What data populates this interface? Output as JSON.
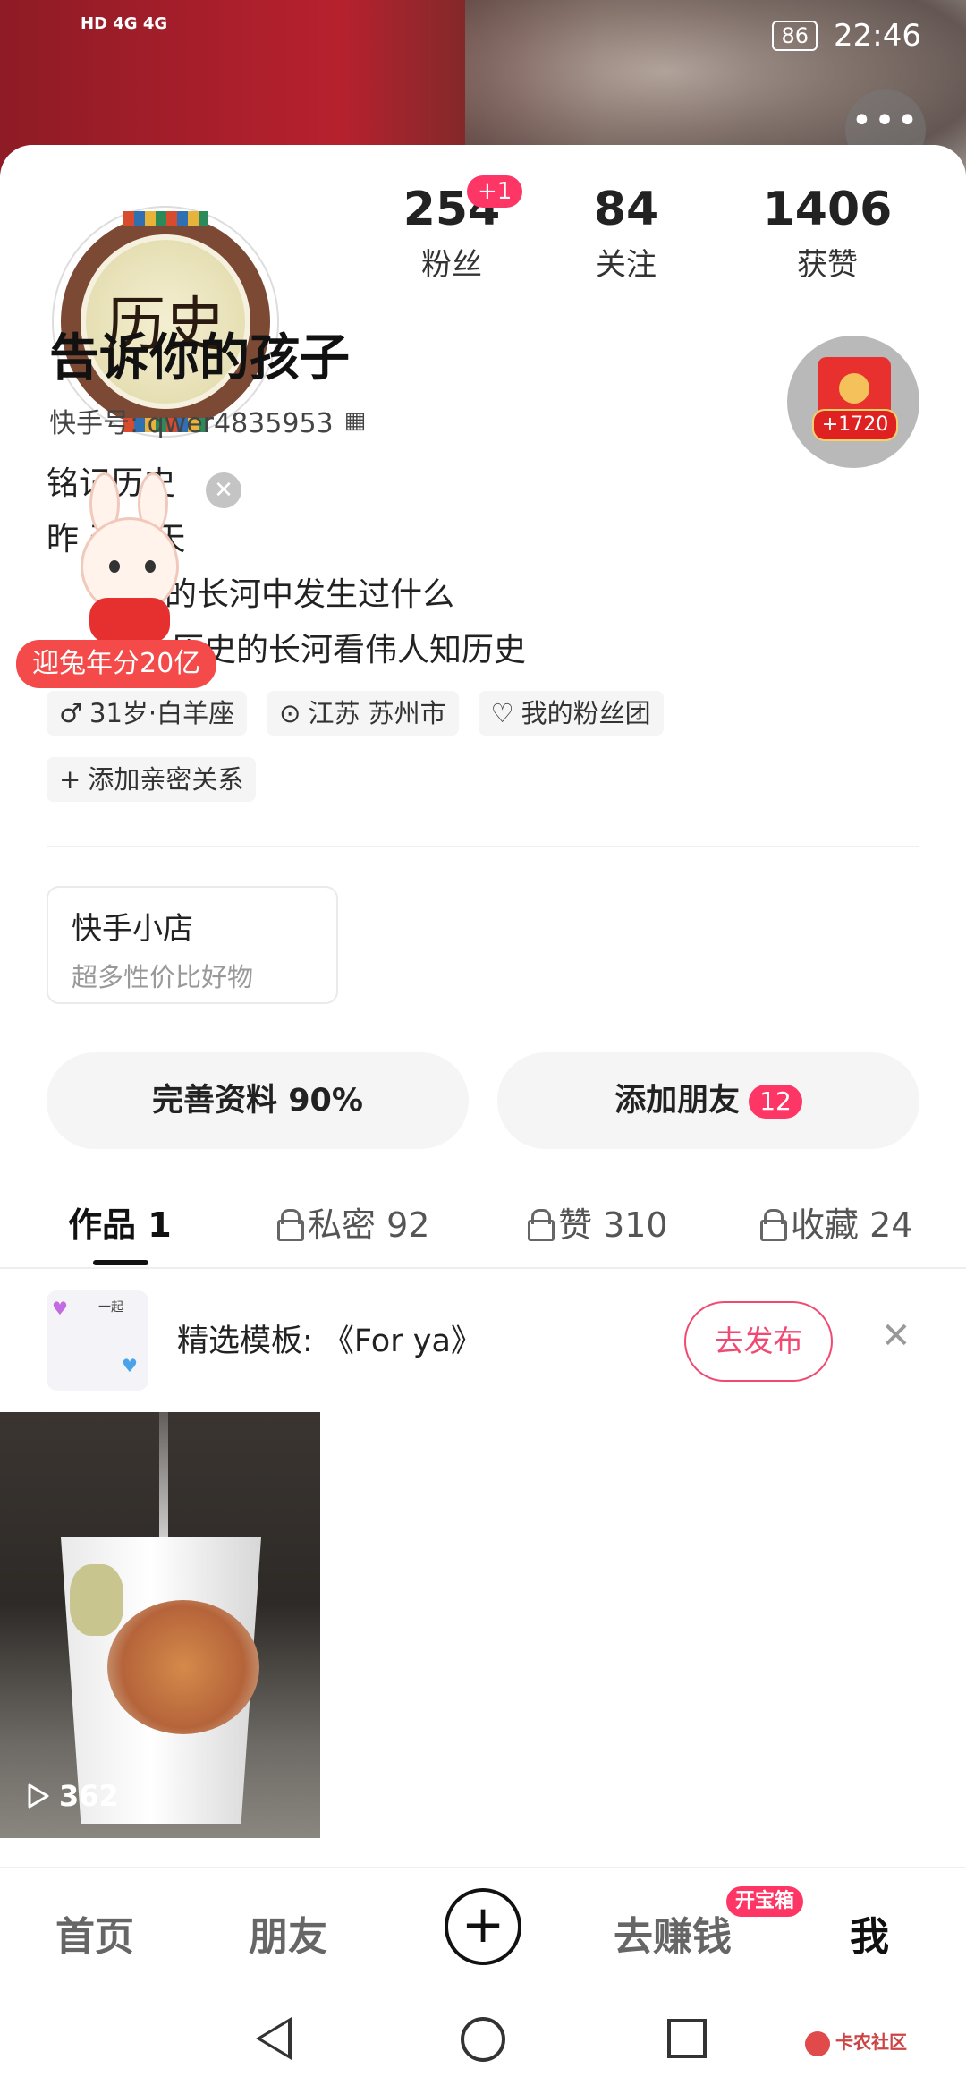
{
  "status_bar": {
    "left": "HD 4G 4G",
    "battery": "86",
    "time": "22:46"
  },
  "profile": {
    "avatar_text": "历史",
    "stats": [
      {
        "value": "254",
        "label": "粉丝",
        "badge": "+1"
      },
      {
        "value": "84",
        "label": "关注"
      },
      {
        "value": "1406",
        "label": "获赞"
      }
    ],
    "username": "告诉你的孩子",
    "kuaishou_id": "快手号: qwer4835953",
    "red_packet_value": "+1720",
    "bio": [
      "铭记历史",
      "昨      天明天",
      "历史的长河中发生过什么",
      "历史的长河看伟人知历史"
    ],
    "promo": "迎兔年分20亿",
    "tags": [
      "31岁·白羊座",
      "江苏 苏州市",
      "我的粉丝团"
    ],
    "add_relation": "添加亲密关系"
  },
  "shop": {
    "title": "快手小店",
    "subtitle": "超多性价比好物"
  },
  "actions": {
    "complete_profile": "完善资料 90%",
    "add_friends": "添加朋友",
    "add_friends_count": "12"
  },
  "tabs": [
    {
      "label": "作品 1",
      "active": true
    },
    {
      "label": "私密 92",
      "locked": true
    },
    {
      "label": "赞 310",
      "locked": true
    },
    {
      "label": "收藏 24",
      "locked": true
    }
  ],
  "template": {
    "thumb_text": "一起",
    "label": "精选模板: 《For ya》",
    "publish": "去发布"
  },
  "video": {
    "views": "362"
  },
  "bottom_nav": {
    "home": "首页",
    "friends": "朋友",
    "earn": "去赚钱",
    "earn_badge": "开宝箱",
    "me": "我"
  },
  "watermark": "卡农社区"
}
